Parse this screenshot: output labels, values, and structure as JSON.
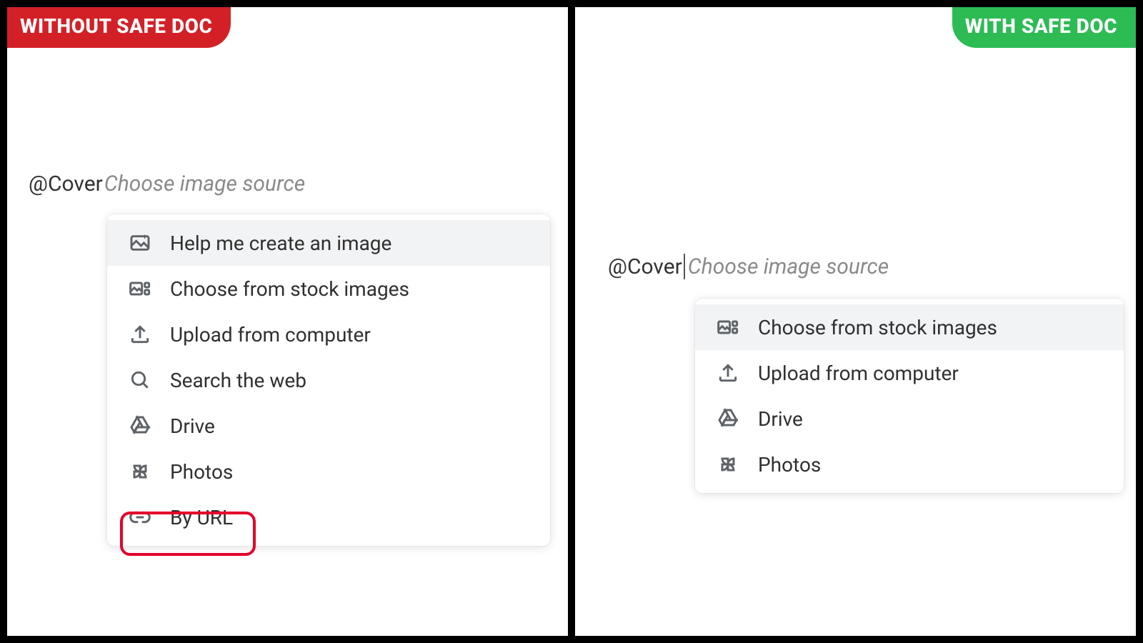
{
  "left": {
    "badge": "WITHOUT SAFE DOC",
    "prefix": "@Cover",
    "hint": "Choose image source",
    "items": {
      "0": {
        "label": "Help me create an image"
      },
      "1": {
        "label": "Choose from stock images"
      },
      "2": {
        "label": "Upload from computer"
      },
      "3": {
        "label": "Search the web"
      },
      "4": {
        "label": "Drive"
      },
      "5": {
        "label": "Photos"
      },
      "6": {
        "label": "By URL"
      }
    }
  },
  "right": {
    "badge": "WITH SAFE DOC",
    "prefix": "@Cover",
    "hint": "Choose image source",
    "items": {
      "0": {
        "label": "Choose from stock images"
      },
      "1": {
        "label": "Upload from computer"
      },
      "2": {
        "label": "Drive"
      },
      "3": {
        "label": "Photos"
      }
    }
  },
  "colors": {
    "badge_left": "#d32027",
    "badge_right": "#2dbb54",
    "callout": "#e4002b"
  }
}
